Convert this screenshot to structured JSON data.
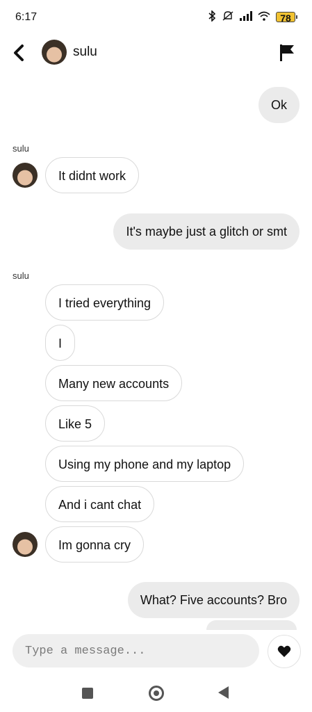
{
  "status_bar": {
    "time": "6:17",
    "battery": "78"
  },
  "header": {
    "contact_name": "sulu"
  },
  "messages": [
    {
      "from": "me",
      "text": "Ok"
    },
    {
      "from": "sulu",
      "sender": "sulu",
      "text": "It didnt work"
    },
    {
      "from": "me",
      "text": "It's maybe just a glitch or smt"
    },
    {
      "from": "sulu",
      "sender": "sulu",
      "text": "I tried everything"
    },
    {
      "from": "sulu",
      "text": "I"
    },
    {
      "from": "sulu",
      "text": "Many new accounts"
    },
    {
      "from": "sulu",
      "text": "Like 5"
    },
    {
      "from": "sulu",
      "text": "Using my phone and my laptop"
    },
    {
      "from": "sulu",
      "text": "And i cant chat"
    },
    {
      "from": "sulu",
      "text": "Im gonna cry"
    },
    {
      "from": "me",
      "text": "What? Five accounts? Bro"
    }
  ],
  "composer": {
    "placeholder": "Type a message..."
  },
  "icons": {
    "back": "chevron-left-icon",
    "report": "flag-icon",
    "like": "heart-icon",
    "status": [
      "bluetooth-icon",
      "mute-icon",
      "signal-icon",
      "wifi-icon",
      "battery-icon"
    ]
  }
}
